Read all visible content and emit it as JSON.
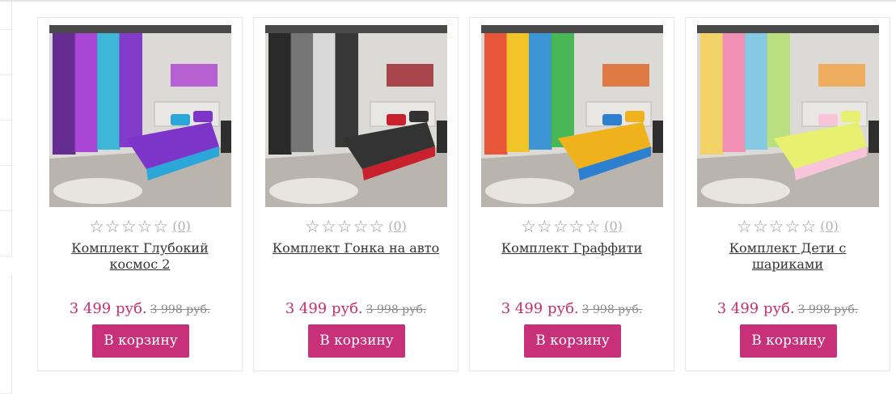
{
  "products": [
    {
      "title": "Комплект Глубокий космос 2",
      "rating_stars": "☆☆☆☆☆",
      "rating_count": "(0)",
      "price": "3 499 руб.",
      "old_price": "3 998 руб.",
      "cart_label": "В корзину",
      "scheme": "cosmos"
    },
    {
      "title": "Комплект Гонка на авто",
      "rating_stars": "☆☆☆☆☆",
      "rating_count": "(0)",
      "price": "3 499 руб.",
      "old_price": "3 998 руб.",
      "cart_label": "В корзину",
      "scheme": "race"
    },
    {
      "title": "Комплект Граффити",
      "rating_stars": "☆☆☆☆☆",
      "rating_count": "(0)",
      "price": "3 499 руб.",
      "old_price": "3 998 руб.",
      "cart_label": "В корзину",
      "scheme": "graffiti"
    },
    {
      "title": "Комплект Дети с шариками",
      "rating_stars": "☆☆☆☆☆",
      "rating_count": "(0)",
      "price": "3 499 руб.",
      "old_price": "3 998 руб.",
      "cart_label": "В корзину",
      "scheme": "balloons"
    }
  ],
  "colors": {
    "accent": "#c9307a",
    "price": "#c6306e",
    "border": "#e6e6e6"
  }
}
